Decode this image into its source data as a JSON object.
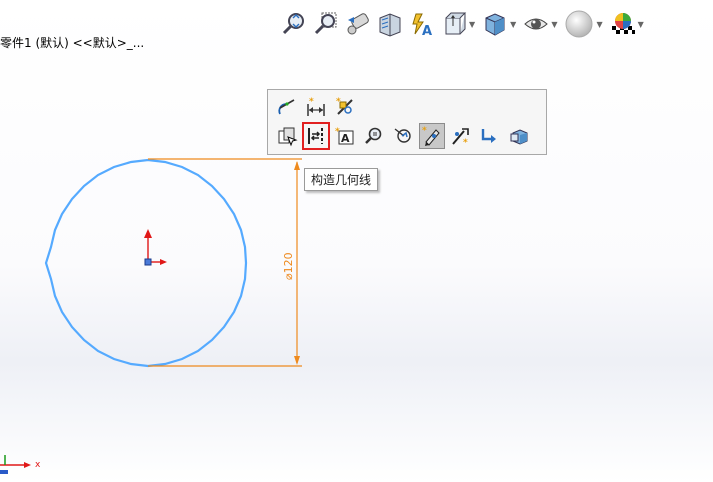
{
  "document": {
    "title": "零件1 (默认) <<默认>_..."
  },
  "toolbar": {
    "items": [
      {
        "icon": "zoom-to-fit-icon"
      },
      {
        "icon": "zoom-to-area-icon"
      },
      {
        "icon": "previous-view-icon"
      },
      {
        "icon": "section-view-icon"
      },
      {
        "icon": "dynamic-annotation-view-icon"
      },
      {
        "icon": "view-orientation-icon",
        "dropdown": true
      },
      {
        "icon": "display-style-icon",
        "dropdown": true
      },
      {
        "icon": "hide-show-items-icon",
        "dropdown": true
      },
      {
        "icon": "edit-appearance-icon",
        "dropdown": true
      },
      {
        "icon": "apply-scene-icon",
        "dropdown": true
      }
    ]
  },
  "context_toolbar": {
    "row1": [
      "tangent-icon",
      "smart-dimension-icon",
      "quick-snaps-icon"
    ],
    "row2": [
      "repair-sketch-icon",
      "construction-geometry-icon",
      "dimension-text-icon",
      "zoom-to-selection-icon",
      "normal-to-icon",
      "sketch-icon",
      "exit-sketch-icon",
      "undo-icon",
      "shaded-sketch-contours-icon"
    ],
    "pressed_index": 5,
    "highlight_index": 1
  },
  "tooltip": {
    "text": "构造几何线"
  },
  "sketch": {
    "dimension_label": "⌀120",
    "dimension_value": 120,
    "colors": {
      "circle": "#55aaff",
      "dimension": "#ee8a1e",
      "highlight": "#e12020"
    }
  },
  "triad": {
    "x_label": "x"
  }
}
